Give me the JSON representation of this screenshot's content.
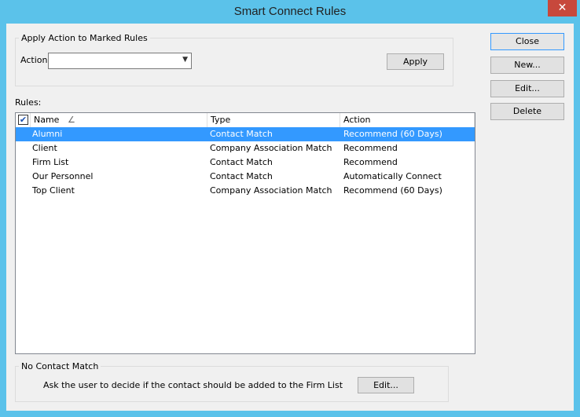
{
  "window": {
    "title": "Smart Connect Rules",
    "close_glyph": "✕"
  },
  "apply_group": {
    "label": "Apply Action to Marked Rules",
    "action_label": "Action:",
    "action_value": "",
    "apply_label": "Apply"
  },
  "side_buttons": {
    "close": "Close",
    "new": "New...",
    "edit": "Edit...",
    "delete": "Delete"
  },
  "rules": {
    "label": "Rules:",
    "columns": {
      "name": "Name",
      "type": "Type",
      "action": "Action"
    },
    "sort_indicator": "∠",
    "rows": [
      {
        "name": "Alumni",
        "type": "Contact Match",
        "action": "Recommend (60 Days)",
        "selected": true
      },
      {
        "name": "Client",
        "type": "Company Association Match",
        "action": "Recommend",
        "selected": false
      },
      {
        "name": "Firm List",
        "type": "Contact Match",
        "action": "Recommend",
        "selected": false
      },
      {
        "name": "Our Personnel",
        "type": "Contact Match",
        "action": "Automatically Connect",
        "selected": false
      },
      {
        "name": "Top Client",
        "type": "Company Association Match",
        "action": "Recommend (60 Days)",
        "selected": false
      }
    ]
  },
  "no_contact": {
    "label": "No Contact Match",
    "description": "Ask the user to decide if the contact should be added to the Firm List",
    "edit_label": "Edit..."
  },
  "colors": {
    "titlebar": "#5bc2ea",
    "selection": "#3399ff",
    "close_red": "#c7483c"
  }
}
